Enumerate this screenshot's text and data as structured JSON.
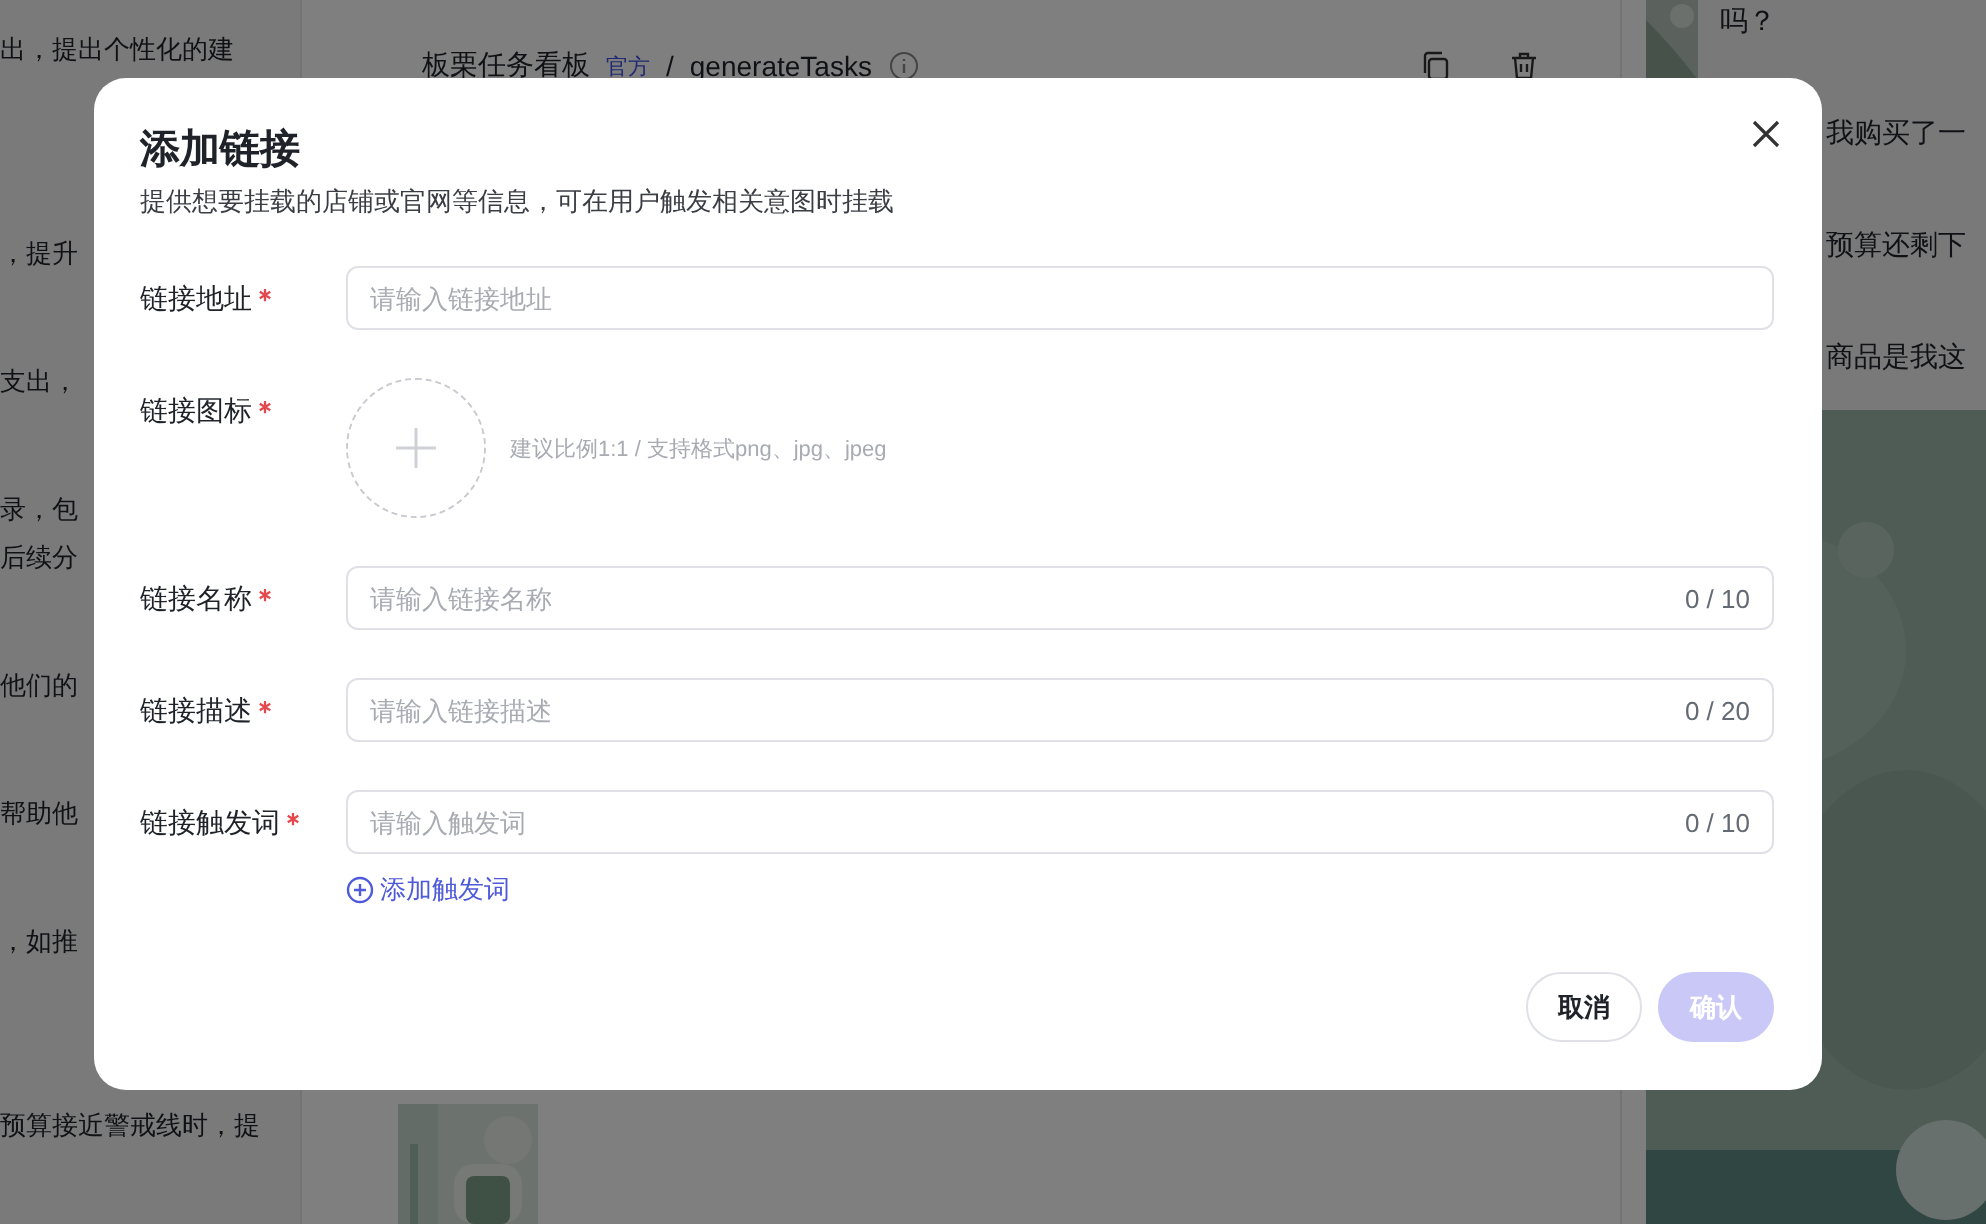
{
  "background": {
    "left_lines": [
      "出，提出个性化的建",
      "，提升",
      "支出，",
      "录，包",
      "后续分",
      "他们的",
      "帮助他",
      "，如推",
      "预算接近警戒线时，提"
    ],
    "header": {
      "breadcrumb": "板栗任务看板",
      "badge": "官方",
      "separator": "/",
      "task": "generateTasks"
    },
    "right_lines": [
      "吗？",
      "我购买了一",
      "预算还剩下",
      "商品是我这"
    ]
  },
  "dialog": {
    "title": "添加链接",
    "subtitle": "提供想要挂载的店铺或官网等信息，可在用户触发相关意图时挂载",
    "fields": [
      {
        "kind": "text",
        "label": "链接地址",
        "required": true,
        "placeholder": "请输入链接地址"
      },
      {
        "kind": "upload",
        "label": "链接图标",
        "required": true,
        "hint": "建议比例1:1 / 支持格式png、jpg、jpeg"
      },
      {
        "kind": "text",
        "label": "链接名称",
        "required": true,
        "placeholder": "请输入链接名称",
        "counter": "0 / 10"
      },
      {
        "kind": "text",
        "label": "链接描述",
        "required": true,
        "placeholder": "请输入链接描述",
        "counter": "0 / 20"
      },
      {
        "kind": "text",
        "label": "链接触发词",
        "required": true,
        "placeholder": "请输入触发词",
        "counter": "0 / 10",
        "add_link": "添加触发词"
      }
    ],
    "buttons": [
      {
        "label": "取消",
        "kind": "secondary",
        "disabled": false
      },
      {
        "label": "确认",
        "kind": "primary",
        "disabled": true
      }
    ]
  }
}
